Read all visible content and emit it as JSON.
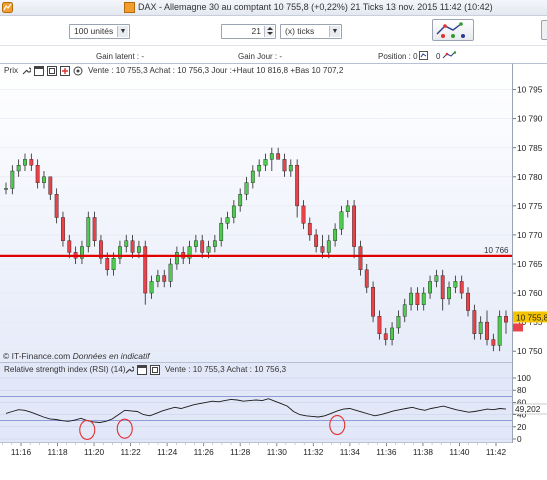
{
  "window": {
    "title": "DAX - Allemagne 30 au comptant (+0,22%)",
    "info": "10 755,8 (+0,22%)   21 Ticks  13 nov. 2015 11:42 (10:42)",
    "title_line": "DAX - Allemagne 30 au comptant    10 755,8 (+0,22%)    21 Ticks    13 nov. 2015 11:42 (10:42)"
  },
  "toolbar": {
    "units_value": "100 unités",
    "ticks_value": "21",
    "ticks_unit_value": "(x) ticks"
  },
  "status": {
    "gain_latent": "Gain latent : -",
    "gain_jour": "Gain Jour : -",
    "position": "Position : 0",
    "position_zero": "0"
  },
  "price_panel": {
    "label": "Prix",
    "info": "Vente : 10 755,3 Achat : 10 756,3 Jour :+Haut 10 816,8 +Bas 10 707,2",
    "footnote_brand": "© IT-Finance.com",
    "footnote_note": "Données en indicatif",
    "level_label": "10 766",
    "current_price_label": "10 755,8"
  },
  "rsi_panel": {
    "label": "Relative strength index (RSI) (14)",
    "info": "Vente : 10 755,3 Achat : 10 756,3",
    "current_value_label": "49,202"
  },
  "colors": {
    "up_candle": "#4fc94f",
    "down_candle": "#e8434b",
    "level_line": "#e00000",
    "rsi_line": "#1a1a1a",
    "circle": "#e03030",
    "current_price_bg": "#f5c400"
  },
  "chart_data": [
    {
      "type": "candlestick",
      "title": "",
      "y_axis": {
        "ticks": [
          10750,
          10755,
          10760,
          10765,
          10770,
          10775,
          10780,
          10785,
          10790,
          10795
        ],
        "tick_labels": [
          "10 750",
          "10 755",
          "10 760",
          "10 765",
          "10 770",
          "10 775",
          "10 780",
          "10 785",
          "10 790",
          "10 795"
        ],
        "ylim": [
          10749,
          10797
        ]
      },
      "x_axis": {
        "tick_labels": [
          "11:16",
          "11:18",
          "11:20",
          "11:22",
          "11:24",
          "11:26",
          "11:28",
          "11:30",
          "11:32",
          "11:34",
          "11:36",
          "11:38",
          "11:40",
          "11:42"
        ]
      },
      "horizontal_line": 10766.4,
      "candles": [
        [
          10778,
          10779,
          10777,
          10778
        ],
        [
          10778,
          10782,
          10777,
          10781
        ],
        [
          10781,
          10783,
          10780,
          10782
        ],
        [
          10782,
          10784,
          10781,
          10783
        ],
        [
          10783,
          10784,
          10781,
          10782
        ],
        [
          10782,
          10783,
          10778,
          10779
        ],
        [
          10779,
          10781,
          10778,
          10780
        ],
        [
          10780,
          10780,
          10776,
          10777
        ],
        [
          10777,
          10778,
          10772,
          10773
        ],
        [
          10773,
          10774,
          10768,
          10769
        ],
        [
          10769,
          10770,
          10766,
          10767
        ],
        [
          10767,
          10768,
          10765,
          10766
        ],
        [
          10766,
          10769,
          10765,
          10768
        ],
        [
          10768,
          10774,
          10767,
          10773
        ],
        [
          10773,
          10774,
          10768,
          10769
        ],
        [
          10769,
          10770,
          10765,
          10766
        ],
        [
          10766,
          10767,
          10763,
          10764
        ],
        [
          10764,
          10767,
          10763,
          10766
        ],
        [
          10766,
          10769,
          10765,
          10768
        ],
        [
          10768,
          10770,
          10767,
          10769
        ],
        [
          10769,
          10770,
          10766,
          10767
        ],
        [
          10767,
          10769,
          10766,
          10768
        ],
        [
          10768,
          10769,
          10758,
          10760
        ],
        [
          10760,
          10763,
          10759,
          10762
        ],
        [
          10762,
          10764,
          10761,
          10763
        ],
        [
          10763,
          10764,
          10761,
          10762
        ],
        [
          10762,
          10766,
          10761,
          10765
        ],
        [
          10765,
          10768,
          10764,
          10767
        ],
        [
          10767,
          10768,
          10765,
          10766
        ],
        [
          10766,
          10769,
          10765,
          10768
        ],
        [
          10768,
          10770,
          10767,
          10769
        ],
        [
          10769,
          10770,
          10766,
          10767
        ],
        [
          10767,
          10769,
          10766,
          10768
        ],
        [
          10768,
          10770,
          10767,
          10769
        ],
        [
          10769,
          10773,
          10768,
          10772
        ],
        [
          10772,
          10774,
          10771,
          10773
        ],
        [
          10773,
          10776,
          10772,
          10775
        ],
        [
          10775,
          10778,
          10774,
          10777
        ],
        [
          10777,
          10780,
          10776,
          10779
        ],
        [
          10779,
          10782,
          10778,
          10781
        ],
        [
          10781,
          10783,
          10780,
          10782
        ],
        [
          10782,
          10784,
          10781,
          10783
        ],
        [
          10783,
          10785,
          10781,
          10784
        ],
        [
          10784,
          10785,
          10783,
          10783
        ],
        [
          10783,
          10784,
          10780,
          10781
        ],
        [
          10781,
          10783,
          10780,
          10782
        ],
        [
          10782,
          10783,
          10773,
          10775
        ],
        [
          10775,
          10776,
          10771,
          10772
        ],
        [
          10772,
          10773,
          10769,
          10770
        ],
        [
          10770,
          10771,
          10767,
          10768
        ],
        [
          10768,
          10770,
          10766,
          10767
        ],
        [
          10767,
          10770,
          10766,
          10769
        ],
        [
          10769,
          10772,
          10768,
          10771
        ],
        [
          10771,
          10775,
          10770,
          10774
        ],
        [
          10774,
          10776,
          10773,
          10775
        ],
        [
          10775,
          10776,
          10766,
          10768
        ],
        [
          10768,
          10769,
          10763,
          10764
        ],
        [
          10764,
          10765,
          10760,
          10761
        ],
        [
          10761,
          10762,
          10755,
          10756
        ],
        [
          10756,
          10757,
          10752,
          10753
        ],
        [
          10753,
          10754,
          10751,
          10752
        ],
        [
          10752,
          10755,
          10751,
          10754
        ],
        [
          10754,
          10757,
          10753,
          10756
        ],
        [
          10756,
          10759,
          10755,
          10758
        ],
        [
          10758,
          10761,
          10757,
          10760
        ],
        [
          10760,
          10761,
          10757,
          10758
        ],
        [
          10758,
          10761,
          10757,
          10760
        ],
        [
          10760,
          10763,
          10759,
          10762
        ],
        [
          10762,
          10764,
          10761,
          10763
        ],
        [
          10763,
          10764,
          10757,
          10759
        ],
        [
          10759,
          10762,
          10758,
          10761
        ],
        [
          10761,
          10763,
          10760,
          10762
        ],
        [
          10762,
          10763,
          10759,
          10760
        ],
        [
          10760,
          10761,
          10756,
          10757
        ],
        [
          10757,
          10758,
          10752,
          10753
        ],
        [
          10753,
          10756,
          10752,
          10755
        ],
        [
          10755,
          10757,
          10751,
          10752
        ],
        [
          10752,
          10753,
          10750,
          10751
        ],
        [
          10751,
          10757,
          10750,
          10756
        ],
        [
          10756,
          10757,
          10753,
          10755
        ]
      ]
    },
    {
      "type": "line",
      "title": "Relative strength index (RSI) (14)",
      "y_axis": {
        "ticks": [
          0,
          20,
          40,
          60,
          80,
          100
        ],
        "ylim": [
          0,
          100
        ]
      },
      "reference_lines": [
        30,
        70
      ],
      "values": [
        42,
        45,
        48,
        47,
        44,
        40,
        36,
        33,
        32,
        30,
        29,
        31,
        34,
        30,
        28,
        27,
        29,
        33,
        40,
        47,
        46,
        45,
        40,
        38,
        42,
        46,
        49,
        52,
        50,
        53,
        56,
        58,
        60,
        62,
        61,
        63,
        65,
        64,
        62,
        63,
        64,
        63,
        66,
        62,
        58,
        54,
        45,
        40,
        38,
        37,
        36,
        38,
        42,
        46,
        49,
        50,
        47,
        44,
        41,
        38,
        40,
        43,
        46,
        48,
        50,
        52,
        49,
        47,
        50,
        52,
        54,
        51,
        48,
        46,
        44,
        45,
        47,
        49,
        48,
        50,
        49
      ],
      "highlight_circles": [
        {
          "x_index": 13,
          "value": 28
        },
        {
          "x_index": 19,
          "value": 30
        },
        {
          "x_index": 53,
          "value": 36
        }
      ],
      "current_value": 49.202
    }
  ]
}
